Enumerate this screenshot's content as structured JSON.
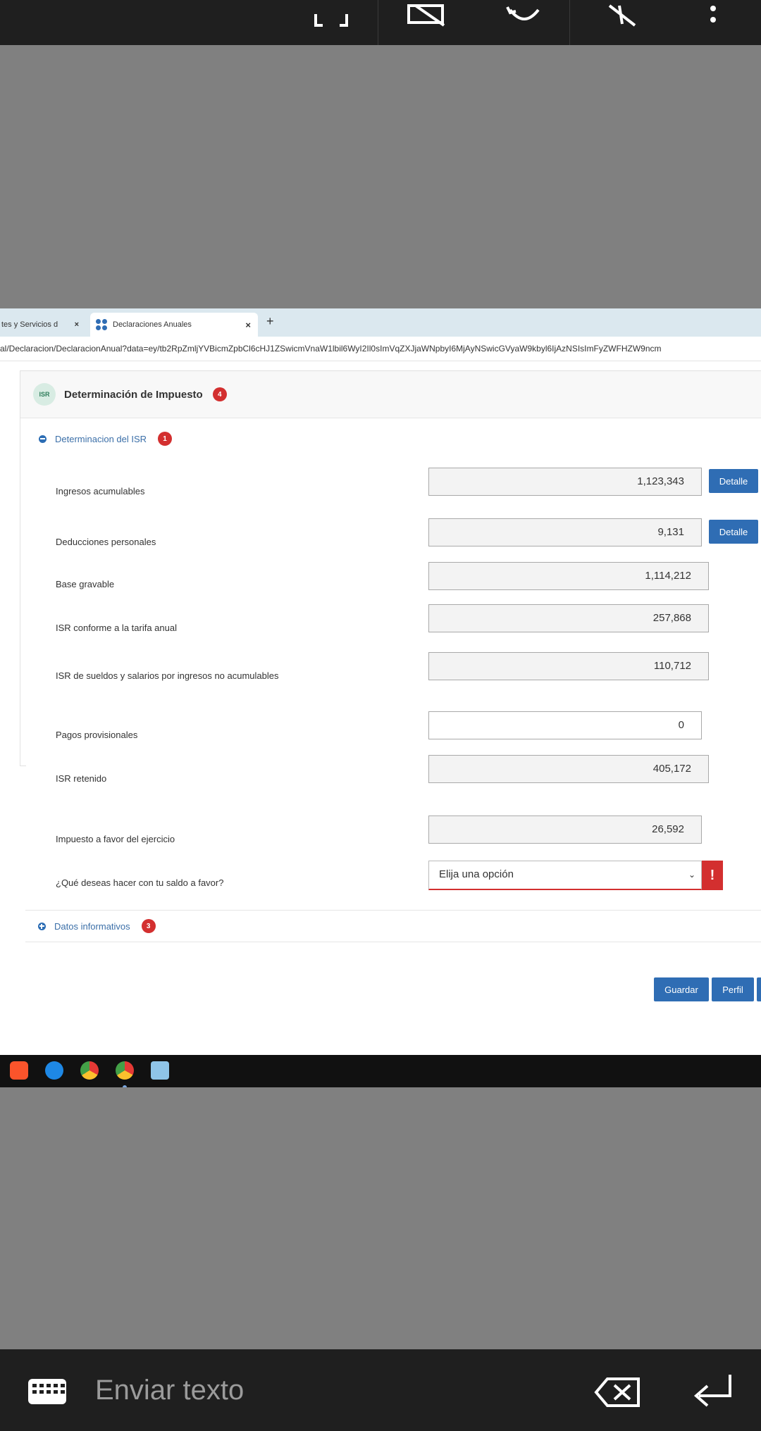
{
  "tabs": [
    {
      "label": "tes y Servicios d",
      "close": "×"
    },
    {
      "label": "Declaraciones Anuales",
      "close": "×"
    }
  ],
  "new_tab": "+",
  "url": "al/Declaracion/DeclaracionAnual?data=ey/tb2RpZmljYVBicmZpbCl6cHJ1ZSwicmVnaW1lbil6WyI2Il0sImVqZXJjaWNpbyI6MjAyNSwicGVyaW9kbyl6IjAzNSIsImFyZWFHZW9ncm",
  "panel": {
    "badge": "ISR",
    "title": "Determinación de Impuesto",
    "count": "4"
  },
  "section1": {
    "title": "Determinacion del ISR",
    "count": "1",
    "rows": [
      {
        "label": "Ingresos acumulables",
        "value": "1,123,343",
        "button": "Detalle"
      },
      {
        "label": "Deducciones personales",
        "value": "9,131",
        "button": "Detalle"
      },
      {
        "label": "Base gravable",
        "value": "1,114,212"
      },
      {
        "label": "ISR conforme a la tarifa anual",
        "value": "257,868"
      },
      {
        "label": "ISR de sueldos y salarios por ingresos no acumulables",
        "value": "110,712"
      },
      {
        "label": "Pagos provisionales",
        "value": "0"
      },
      {
        "label": "ISR retenido",
        "value": "405,172"
      },
      {
        "label": "Impuesto a favor del ejercicio",
        "value": "26,592"
      }
    ],
    "question": "¿Qué deseas hacer con tu saldo a favor?",
    "select_value": "Elija una opción",
    "warning": "!"
  },
  "section2": {
    "title": "Datos informativos",
    "count": "3"
  },
  "actions": {
    "save": "Guardar",
    "profile": "Perfil"
  },
  "bottom": {
    "placeholder": "Enviar texto"
  },
  "colors": {
    "accent": "#2f6db4",
    "alert": "#d32f2f",
    "background": "#808080",
    "bar": "#1f1f1f"
  }
}
